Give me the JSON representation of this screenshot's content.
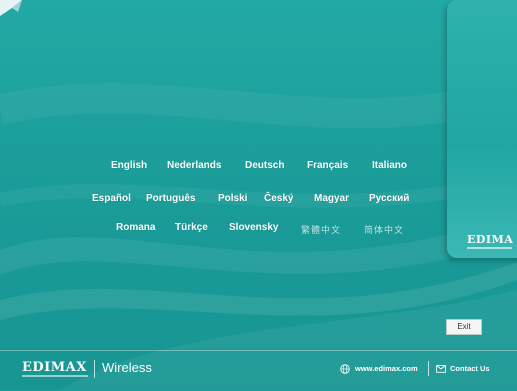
{
  "languages": {
    "row1": [
      "English",
      "Nederlands",
      "Deutsch",
      "Français",
      "Italiano"
    ],
    "row2": [
      "Español",
      "Português",
      "Polski",
      "Český",
      "Magyar",
      "Русский"
    ],
    "row3": [
      "Romana",
      "Türkçe",
      "Slovensky",
      "繁體中文",
      "简体中文"
    ]
  },
  "exit_label": "Exit",
  "footer": {
    "brand": "EDIMAX",
    "product": "Wireless",
    "website": "www.edimax.com",
    "contact": "Contact Us"
  },
  "side_panel": {
    "logo": "EDIMA"
  },
  "colors": {
    "background": "#1b9d9a",
    "text": "#ffffff"
  },
  "icons": [
    "globe-icon",
    "contact-icon"
  ]
}
